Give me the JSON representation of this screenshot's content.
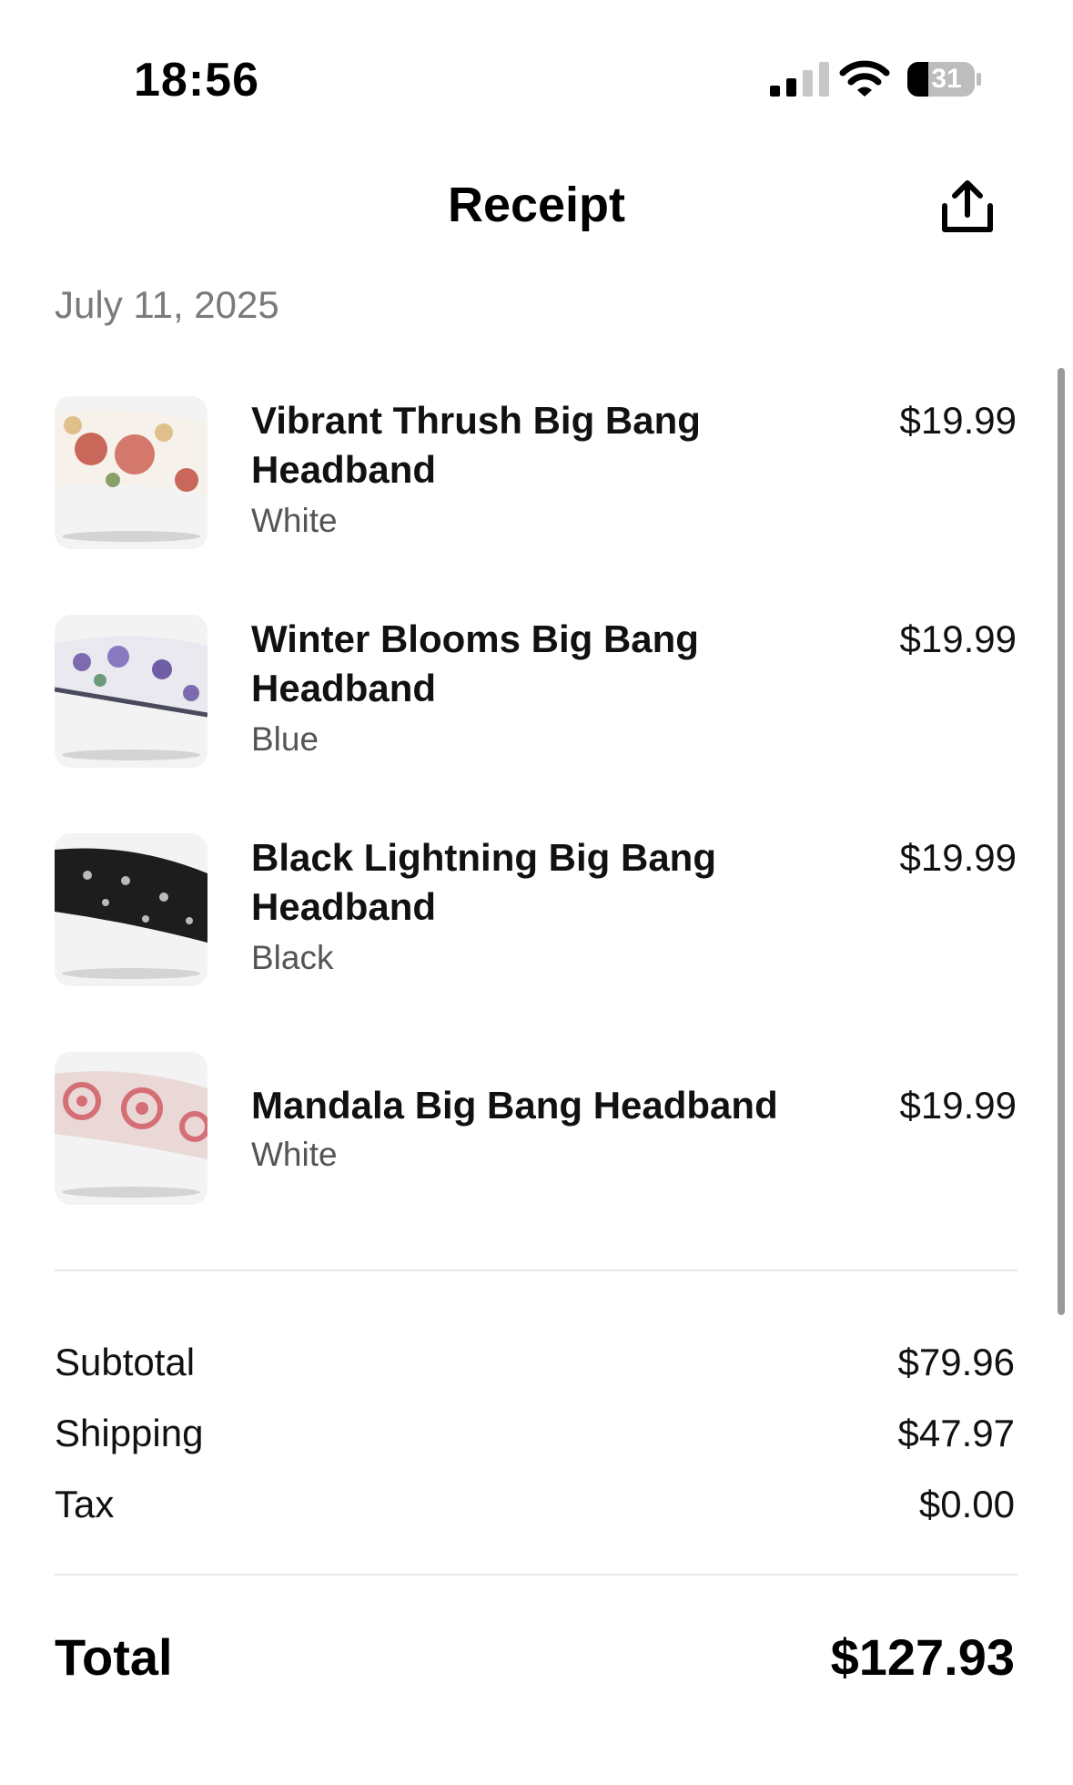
{
  "status_bar": {
    "time": "18:56",
    "battery_level": "31",
    "icons": [
      "cellular-signal-icon",
      "wifi-icon",
      "battery-icon"
    ]
  },
  "header": {
    "title": "Receipt",
    "share_icon": "share-icon"
  },
  "date": "July 11, 2025",
  "items": [
    {
      "name": "Vibrant Thrush Big Bang Headband",
      "variant": "White",
      "price": "$19.99"
    },
    {
      "name": "Winter Blooms Big Bang Headband",
      "variant": "Blue",
      "price": "$19.99"
    },
    {
      "name": "Black Lightning Big Bang Headband",
      "variant": "Black",
      "price": "$19.99"
    },
    {
      "name": "Mandala Big Bang Headband",
      "variant": "White",
      "price": "$19.99"
    }
  ],
  "summary": {
    "subtotal_label": "Subtotal",
    "subtotal_value": "$79.96",
    "shipping_label": "Shipping",
    "shipping_value": "$47.97",
    "tax_label": "Tax",
    "tax_value": "$0.00"
  },
  "total": {
    "label": "Total",
    "value": "$127.93"
  },
  "colors": {
    "text": "#111111",
    "muted": "#7a7a7a",
    "divider": "#e6e6e6"
  }
}
